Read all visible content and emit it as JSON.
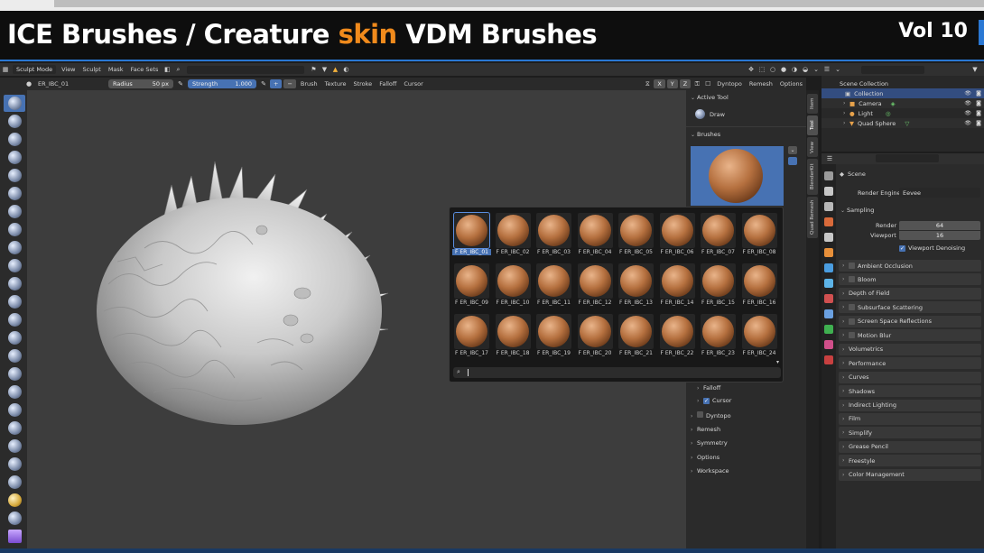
{
  "banner": {
    "title_part1": "ICE Brushes / Creature ",
    "title_accent": "skin",
    "title_part2": " VDM Brushes",
    "volume": "Vol 10",
    "accent_color": "#f08a1c",
    "brand_blue": "#2a78d4"
  },
  "header": {
    "mode": "Sculpt Mode",
    "menus": [
      "View",
      "Sculpt",
      "Mask",
      "Face Sets"
    ],
    "dyntopo": "Dyntopo",
    "remesh": "Remesh",
    "options": "Options",
    "axes": [
      "X",
      "Y",
      "Z"
    ]
  },
  "toolsettings": {
    "brush_name": "ER_IBC_01",
    "radius_label": "Radius",
    "radius_value": "50 px",
    "strength_label": "Strength",
    "strength_value": "1.000",
    "menus": [
      "Brush",
      "Texture",
      "Stroke",
      "Falloff",
      "Cursor"
    ]
  },
  "sidebar": {
    "tabs": [
      "Item",
      "Tool",
      "View",
      "BlenderKit",
      "Quad Remesh"
    ],
    "active_tool_header": "Active Tool",
    "active_tool": "Draw",
    "brushes_header": "Brushes",
    "falloff": "Falloff",
    "cursor": "Cursor",
    "sections": [
      "Dyntopo",
      "Remesh",
      "Symmetry",
      "Options",
      "Workspace"
    ]
  },
  "brush_grid": {
    "labels": [
      "F ER_IBC_01",
      "F ER_IBC_02",
      "F ER_IBC_03",
      "F ER_IBC_04",
      "F ER_IBC_05",
      "F ER_IBC_06",
      "F ER_IBC_07",
      "F ER_IBC_08",
      "F ER_IBC_09",
      "F ER_IBC_10",
      "F ER_IBC_11",
      "F ER_IBC_12",
      "F ER_IBC_13",
      "F ER_IBC_14",
      "F ER_IBC_15",
      "F ER_IBC_16",
      "F ER_IBC_17",
      "F ER_IBC_18",
      "F ER_IBC_19",
      "F ER_IBC_20",
      "F ER_IBC_21",
      "F ER_IBC_22",
      "F ER_IBC_23",
      "F ER_IBC_24"
    ]
  },
  "outliner": {
    "root": "Scene Collection",
    "collection": "Collection",
    "objects": [
      "Camera",
      "Light",
      "Quad Sphere"
    ]
  },
  "properties": {
    "scene": "Scene",
    "render_engine_label": "Render Engine",
    "render_engine": "Eevee",
    "sampling": "Sampling",
    "render_label": "Render",
    "render_value": "64",
    "viewport_label": "Viewport",
    "viewport_value": "16",
    "viewport_denoising": "Viewport Denoising",
    "panels": [
      "Ambient Occlusion",
      "Bloom",
      "Depth of Field",
      "Subsurface Scattering",
      "Screen Space Reflections",
      "Motion Blur",
      "Volumetrics",
      "Performance",
      "Curves",
      "Shadows",
      "Indirect Lighting",
      "Film",
      "Simplify",
      "Grease Pencil",
      "Freestyle",
      "Color Management"
    ]
  }
}
